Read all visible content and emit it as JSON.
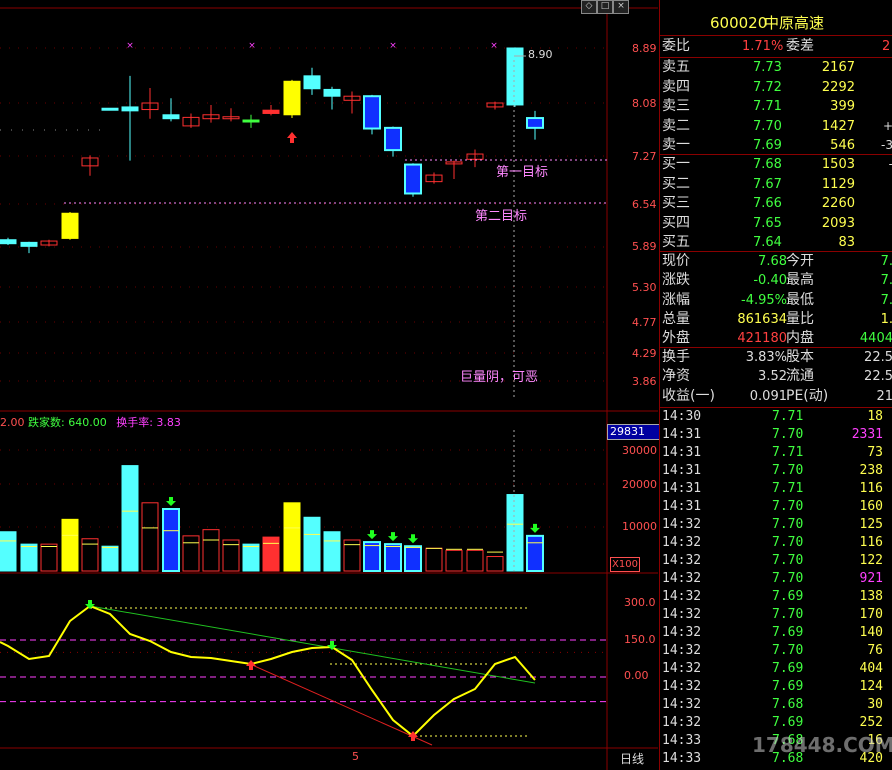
{
  "header": {
    "title_fragment": "…",
    "window_buttons": [
      "◇",
      "□",
      "×"
    ],
    "top_right_tabs": [
      "……",
      "……",
      "……",
      "……"
    ]
  },
  "price_axis": [
    "8.89",
    "8.08",
    "7.27",
    "6.54",
    "5.89",
    "5.30",
    "4.77",
    "4.29",
    "3.86"
  ],
  "annotations": {
    "peak_value": "8.90",
    "target1": "第一目标",
    "target2": "第二目标",
    "comment": "巨量阴，可恶"
  },
  "volume_panel": {
    "legend_prefix": "2.00",
    "legend_down": "跌家数: 640.00",
    "legend_turnover": "换手率: 3.83",
    "current_volume": "29831",
    "axis": [
      "30000",
      "20000",
      "10000"
    ],
    "unit": "X100"
  },
  "indicator_panel": {
    "axis": [
      "300.0",
      "150.0",
      "0.00"
    ]
  },
  "bottom": {
    "period_label": "日线",
    "date_marker": "5"
  },
  "quote": {
    "code": "600020",
    "name": "中原高速",
    "weibi_label": "委比",
    "weibi_value": "1.71%",
    "weicha_label": "委差",
    "weicha_value": "2",
    "asks": [
      {
        "label": "卖五",
        "price": "7.73",
        "vol": "2167",
        "extra": ""
      },
      {
        "label": "卖四",
        "price": "7.72",
        "vol": "2292",
        "extra": ""
      },
      {
        "label": "卖三",
        "price": "7.71",
        "vol": "399",
        "extra": ""
      },
      {
        "label": "卖二",
        "price": "7.70",
        "vol": "1427",
        "extra": "+"
      },
      {
        "label": "卖一",
        "price": "7.69",
        "vol": "546",
        "extra": "-3"
      }
    ],
    "bids": [
      {
        "label": "买一",
        "price": "7.68",
        "vol": "1503",
        "extra": "-"
      },
      {
        "label": "买二",
        "price": "7.67",
        "vol": "1129",
        "extra": ""
      },
      {
        "label": "买三",
        "price": "7.66",
        "vol": "2260",
        "extra": ""
      },
      {
        "label": "买四",
        "price": "7.65",
        "vol": "2093",
        "extra": ""
      },
      {
        "label": "买五",
        "price": "7.64",
        "vol": "83",
        "extra": ""
      }
    ],
    "stats": [
      {
        "l1": "现价",
        "v1": "7.68",
        "l2": "今开",
        "v2": "7."
      },
      {
        "l1": "涨跌",
        "v1": "-0.40",
        "l2": "最高",
        "v2": "7."
      },
      {
        "l1": "涨幅",
        "v1": "-4.95%",
        "l2": "最低",
        "v2": "7."
      },
      {
        "l1": "总量",
        "v1": "861634",
        "l2": "量比",
        "v2": "1."
      },
      {
        "l1": "外盘",
        "v1": "421180",
        "l2": "内盘",
        "v2": "4404"
      }
    ],
    "stats2": [
      {
        "l1": "换手",
        "v1": "3.83%",
        "l2": "股本",
        "v2": "22.5"
      },
      {
        "l1": "净资",
        "v1": "3.52",
        "l2": "流通",
        "v2": "22.5"
      },
      {
        "l1": "收益(一)",
        "v1": "0.091",
        "l2": "PE(动)",
        "v2": "21"
      }
    ]
  },
  "ticks": [
    {
      "time": "14:30",
      "price": "7.71",
      "vol": "18",
      "color": "#ffff50"
    },
    {
      "time": "14:31",
      "price": "7.70",
      "vol": "2331",
      "color": "#ff40ff"
    },
    {
      "time": "14:31",
      "price": "7.71",
      "vol": "73",
      "color": "#ffff50"
    },
    {
      "time": "14:31",
      "price": "7.70",
      "vol": "238",
      "color": "#ffff50"
    },
    {
      "time": "14:31",
      "price": "7.71",
      "vol": "116",
      "color": "#ffff50"
    },
    {
      "time": "14:31",
      "price": "7.70",
      "vol": "160",
      "color": "#ffff50"
    },
    {
      "time": "14:32",
      "price": "7.70",
      "vol": "125",
      "color": "#ffff50"
    },
    {
      "time": "14:32",
      "price": "7.70",
      "vol": "116",
      "color": "#ffff50"
    },
    {
      "time": "14:32",
      "price": "7.70",
      "vol": "122",
      "color": "#ffff50"
    },
    {
      "time": "14:32",
      "price": "7.70",
      "vol": "921",
      "color": "#ff40ff"
    },
    {
      "time": "14:32",
      "price": "7.69",
      "vol": "138",
      "color": "#ffff50"
    },
    {
      "time": "14:32",
      "price": "7.70",
      "vol": "170",
      "color": "#ffff50"
    },
    {
      "time": "14:32",
      "price": "7.69",
      "vol": "140",
      "color": "#ffff50"
    },
    {
      "time": "14:32",
      "price": "7.70",
      "vol": "76",
      "color": "#ffff50"
    },
    {
      "time": "14:32",
      "price": "7.69",
      "vol": "404",
      "color": "#ffff50"
    },
    {
      "time": "14:32",
      "price": "7.69",
      "vol": "124",
      "color": "#ffff50"
    },
    {
      "time": "14:32",
      "price": "7.68",
      "vol": "30",
      "color": "#ffff50"
    },
    {
      "time": "14:32",
      "price": "7.69",
      "vol": "252",
      "color": "#ffff50"
    },
    {
      "time": "14:33",
      "price": "7.68",
      "vol": "16",
      "color": "#ffff50"
    },
    {
      "time": "14:33",
      "price": "7.68",
      "vol": "420",
      "color": "#ffff50"
    }
  ],
  "watermark": "178448.COM",
  "colors": {
    "up": "#ff3030",
    "down": "#54ffff",
    "price_green": "#40ff40",
    "price_red": "#ff4040",
    "label_cyan": "#8cf",
    "border": "#8a0000"
  }
}
